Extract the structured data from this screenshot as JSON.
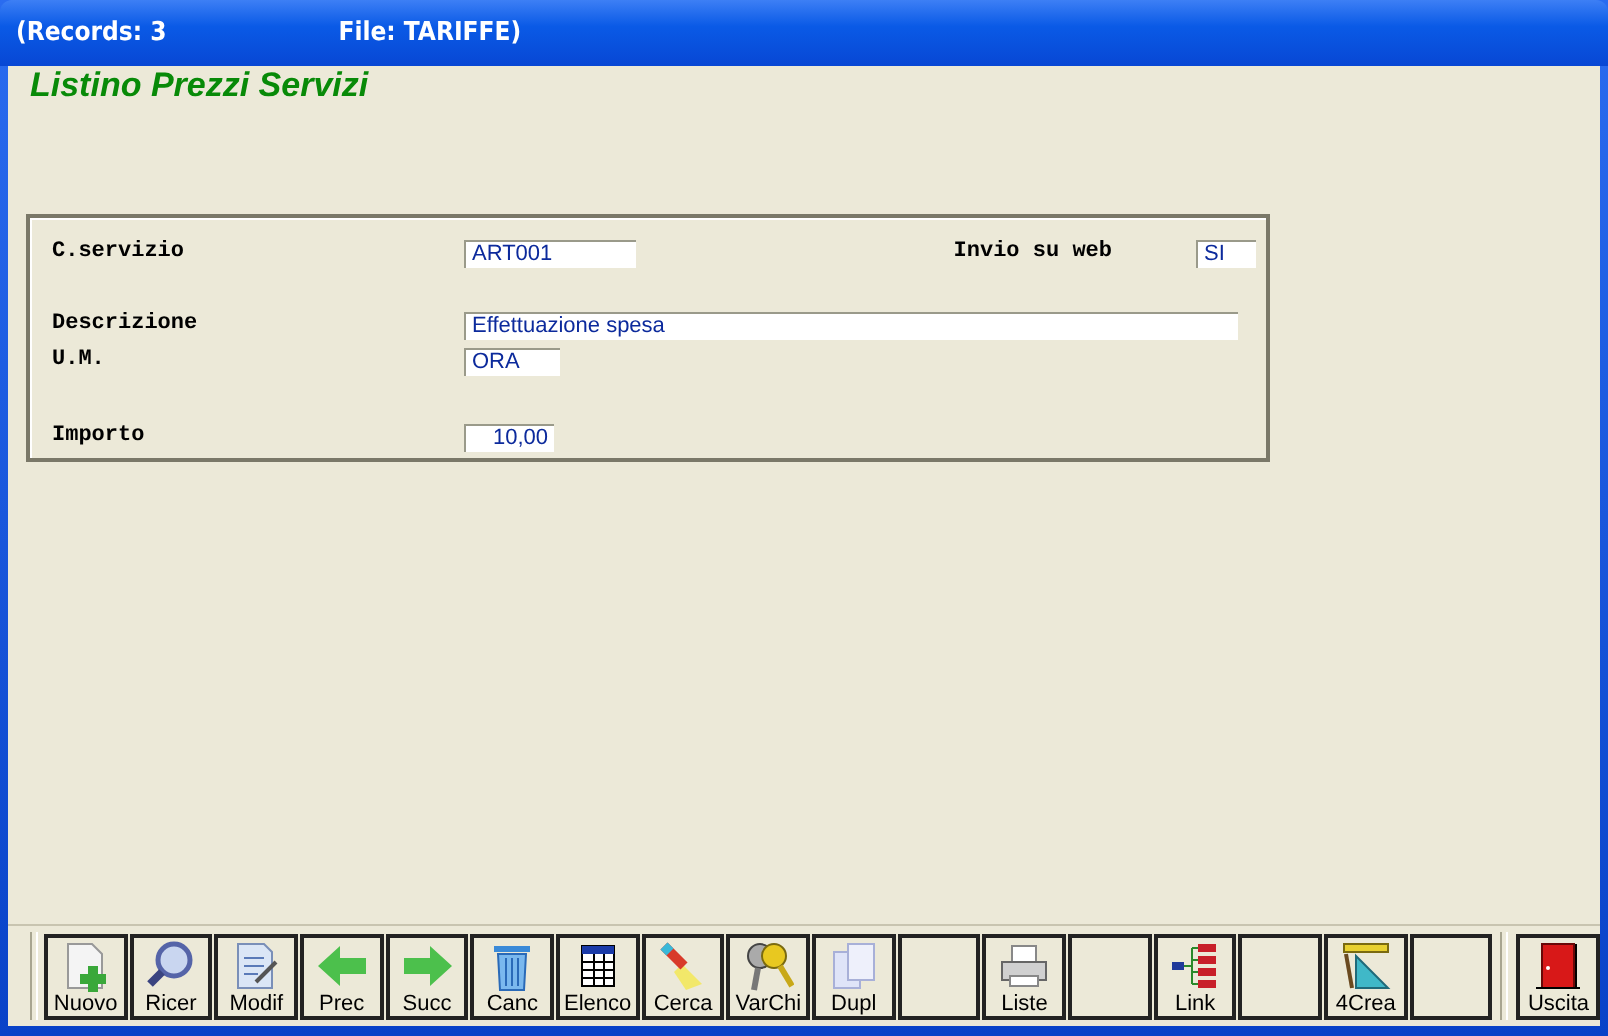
{
  "window": {
    "records": "(Records: 3",
    "file": "File: TARIFFE)"
  },
  "heading": "Listino Prezzi Servizi",
  "form": {
    "codice": {
      "label": "C.servizio",
      "value": "ART001"
    },
    "web": {
      "label": "Invio su web",
      "value": "SI"
    },
    "descrizione": {
      "label": "Descrizione",
      "value": "Effettuazione spesa"
    },
    "um": {
      "label": "U.M.",
      "value": "ORA"
    },
    "importo": {
      "label": "Importo",
      "value": "10,00"
    }
  },
  "toolbar": [
    {
      "kind": "new",
      "label": "Nuovo"
    },
    {
      "kind": "search",
      "label": "Ricer"
    },
    {
      "kind": "edit",
      "label": "Modif"
    },
    {
      "kind": "prev",
      "label": "Prec"
    },
    {
      "kind": "next",
      "label": "Succ"
    },
    {
      "kind": "trash",
      "label": "Canc"
    },
    {
      "kind": "table",
      "label": "Elenco"
    },
    {
      "kind": "torch",
      "label": "Cerca"
    },
    {
      "kind": "keys",
      "label": "VarChi"
    },
    {
      "kind": "copy",
      "label": "Dupl"
    },
    {
      "kind": "blank"
    },
    {
      "kind": "print",
      "label": "Liste"
    },
    {
      "kind": "blank"
    },
    {
      "kind": "tree",
      "label": "Link"
    },
    {
      "kind": "blank"
    },
    {
      "kind": "ruler",
      "label": "4Crea"
    },
    {
      "kind": "blank"
    },
    {
      "kind": "door",
      "label": "Uscita"
    }
  ]
}
